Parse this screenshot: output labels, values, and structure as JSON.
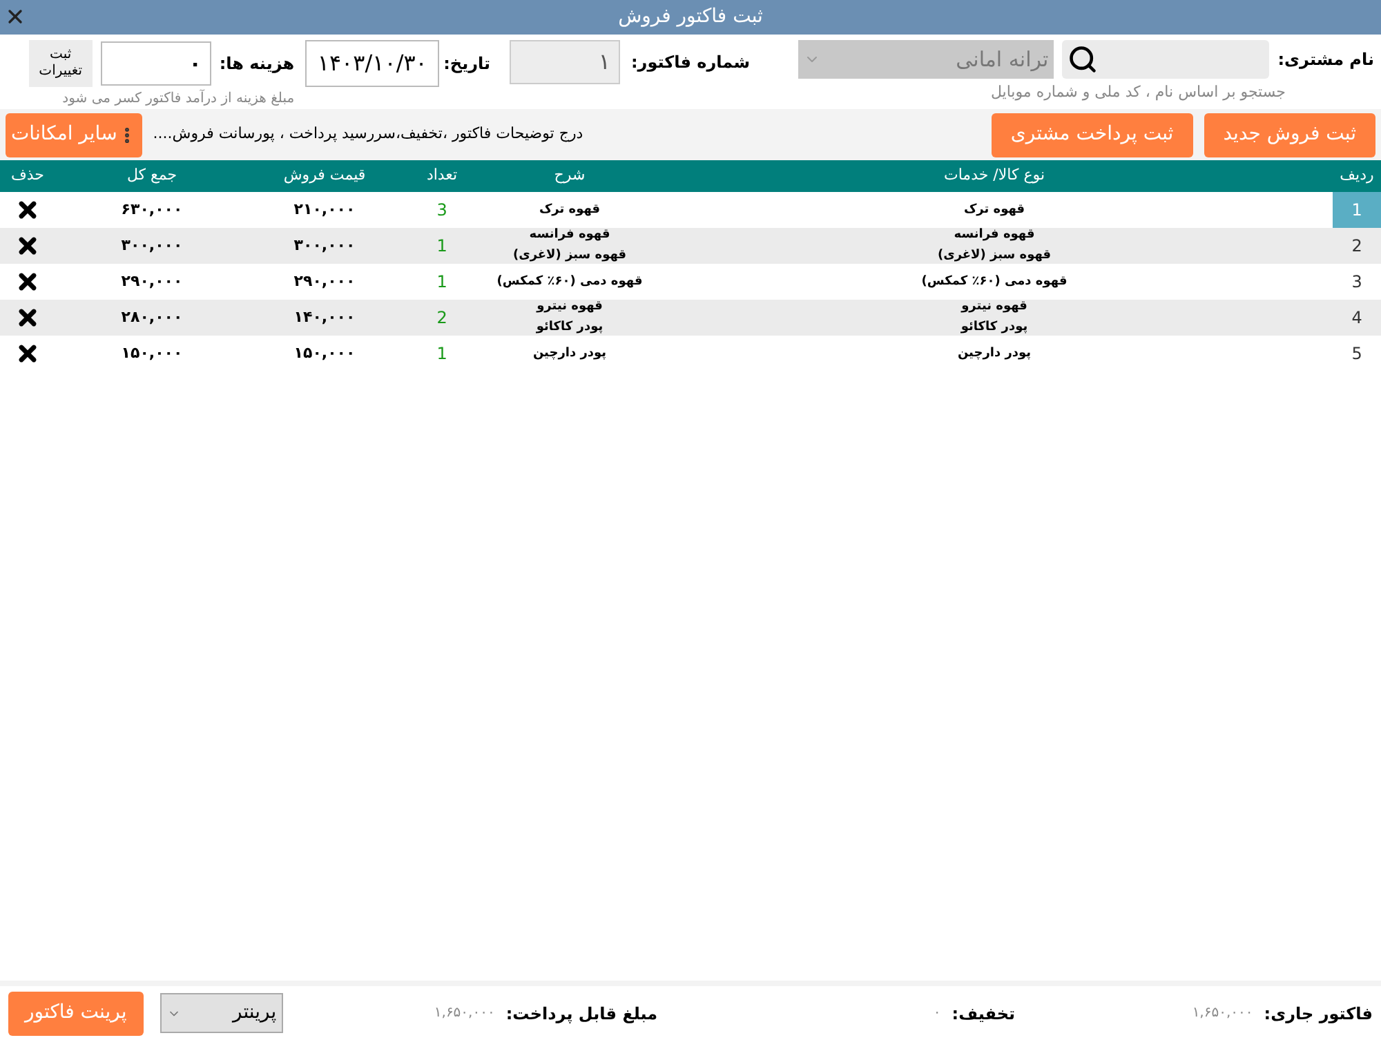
{
  "window": {
    "title": "ثبت فاکتور فروش"
  },
  "customer": {
    "label": "نام مشتری:",
    "search_hint": "جستجو بر اساس نام ، کد ملی و شماره موبایل",
    "selected_name": "ترانه امانی"
  },
  "invoice_number": {
    "label": "شماره فاکتور:",
    "value": "۱"
  },
  "date": {
    "label": "تاریخ:",
    "value": "۱۴۰۳/۱۰/۳۰"
  },
  "costs": {
    "label": "هزینه ها:",
    "value": "۰",
    "note": "مبلغ هزینه از درآمد فاکتور کسر می شود"
  },
  "save_changes_button": "ثبت تغییرات",
  "toolbar": {
    "buttons": [
      "ثبت فروش جدید",
      "ثبت پرداخت مشتری"
    ],
    "description": "درج توضیحات فاکتور ،تخفیف،سررسید پرداخت ، پورسانت فروش....",
    "more_button": "سایر امکانات"
  },
  "table": {
    "columns": [
      "ردیف",
      "نوع کالا/ خدمات",
      "شرح",
      "تعداد",
      "قیمت فروش",
      "جمع کل",
      "حذف"
    ],
    "rows": [
      {
        "index": "1",
        "selected": true,
        "product": [
          "قهوه ترک"
        ],
        "description": [
          "قهوه ترک"
        ],
        "quantity": "3",
        "price": "۲۱۰,۰۰۰",
        "total": "۶۳۰,۰۰۰"
      },
      {
        "index": "2",
        "selected": false,
        "product": [
          "قهوه فرانسه",
          "قهوه سبز (لاغری)"
        ],
        "description": [
          "قهوه فرانسه",
          "قهوه سبز (لاغری)"
        ],
        "quantity": "1",
        "price": "۳۰۰,۰۰۰",
        "total": "۳۰۰,۰۰۰"
      },
      {
        "index": "3",
        "selected": false,
        "product": [
          "قهوه دمی (۶۰٪ کمکس)"
        ],
        "description": [
          "قهوه دمی (۶۰٪ کمکس)"
        ],
        "quantity": "1",
        "price": "۲۹۰,۰۰۰",
        "total": "۲۹۰,۰۰۰"
      },
      {
        "index": "4",
        "selected": false,
        "product": [
          "قهوه نیترو",
          "پودر کاکائو"
        ],
        "description": [
          "قهوه نیترو",
          "پودر کاکائو"
        ],
        "quantity": "2",
        "price": "۱۴۰,۰۰۰",
        "total": "۲۸۰,۰۰۰"
      },
      {
        "index": "5",
        "selected": false,
        "product": [
          "پودر دارچین"
        ],
        "description": [
          "پودر دارچین"
        ],
        "quantity": "1",
        "price": "۱۵۰,۰۰۰",
        "total": "۱۵۰,۰۰۰"
      }
    ]
  },
  "footer": {
    "totals": [
      {
        "label": "فاکتور جاری:",
        "value": "۱,۶۵۰,۰۰۰"
      },
      {
        "label": "تخفیف:",
        "value": "۰"
      },
      {
        "label": "مبلغ قابل پرداخت:",
        "value": "۱,۶۵۰,۰۰۰"
      }
    ],
    "printer_select": "پرینتر",
    "print_button": "پرینت فاکتور"
  }
}
